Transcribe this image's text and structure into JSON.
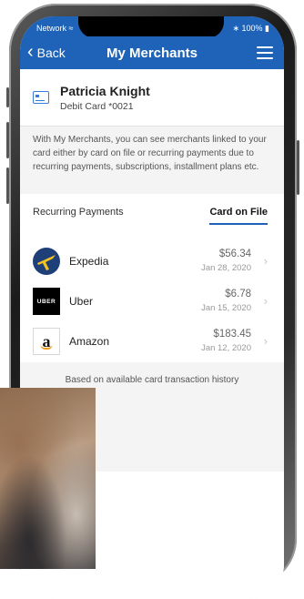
{
  "status_bar": {
    "carrier": "Network",
    "battery": "100%"
  },
  "nav": {
    "back_label": "Back",
    "title": "My Merchants"
  },
  "card": {
    "holder_name": "Patricia Knight",
    "card_label": "Debit Card *0021"
  },
  "info_text": "With My Merchants, you can see merchants linked to your card either by card on file or recurring payments due to recurring payments, subscriptions, installment plans etc.",
  "tabs": [
    {
      "label": "Recurring Payments",
      "active": false
    },
    {
      "label": "Card on File",
      "active": true
    }
  ],
  "merchants": [
    {
      "name": "Expedia",
      "amount": "$56.34",
      "date": "Jan 28, 2020",
      "logo": "expedia-logo"
    },
    {
      "name": "Uber",
      "amount": "$6.78",
      "date": "Jan 15, 2020",
      "logo": "uber-logo",
      "logo_text": "UBER"
    },
    {
      "name": "Amazon",
      "amount": "$183.45",
      "date": "Jan 12, 2020",
      "logo": "amazon-logo",
      "logo_text": "a"
    }
  ],
  "footnote": "Based on available card transaction history",
  "colors": {
    "brand_blue": "#1e63b8",
    "expedia_yellow": "#f5c51e",
    "amazon_orange": "#f29a1a"
  }
}
